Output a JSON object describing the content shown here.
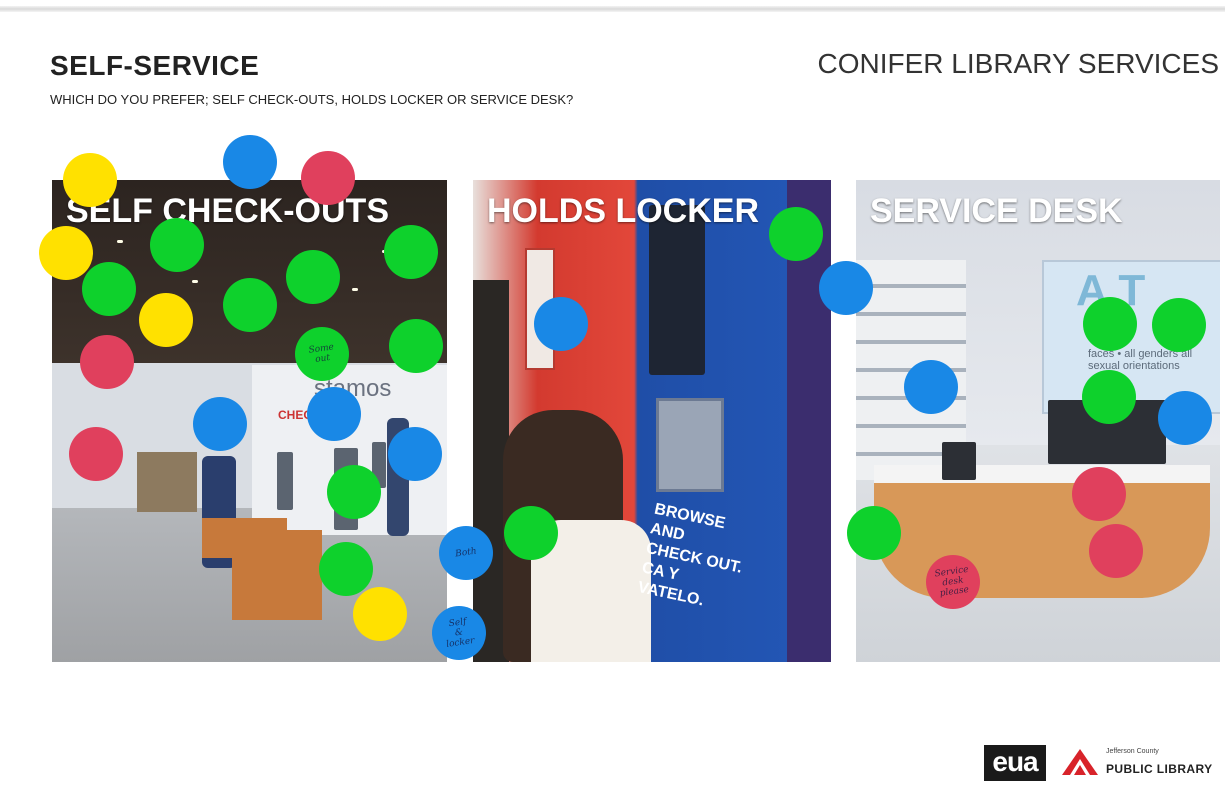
{
  "header": {
    "title": "SELF-SERVICE",
    "org": "CONIFER LIBRARY SERVICES",
    "question": "WHICH DO YOU PREFER; SELF CHECK-OUTS, HOLDS LOCKER OR SERVICE DESK?"
  },
  "panels": [
    {
      "label": "SELF CHECK-OUTS",
      "wall_text": "stamos",
      "wall_red": "CHECK"
    },
    {
      "label": "HOLDS LOCKER",
      "sign": "BROWSE AND\nCHECK OUT.\nCA Y\nVATELO."
    },
    {
      "label": "SERVICE DESK",
      "sign_big": "A  T",
      "sign_text": "faces • all genders\nall sexual orientations"
    }
  ],
  "colors": {
    "yellow": "#ffe100",
    "green": "#0ed12c",
    "blue": "#1988e6",
    "pink": "#e0405d"
  },
  "votes": {
    "self_checkouts": {
      "yellow": 4,
      "green": 11,
      "blue": 4,
      "pink": 3
    },
    "holds_locker": {
      "green": 2,
      "blue": 4
    },
    "service_desk": {
      "green": 5,
      "blue": 2,
      "pink": 3
    }
  },
  "dot_notes": {
    "green_note": "Some\nout",
    "blue_note_both": "Both",
    "blue_note_self": "Self\n&\nlocker",
    "pink_note": "Service\ndesk\nplease"
  },
  "footer": {
    "eua_logo": "eua",
    "library_small": "Jefferson County",
    "library_name": "PUBLIC LIBRARY"
  }
}
